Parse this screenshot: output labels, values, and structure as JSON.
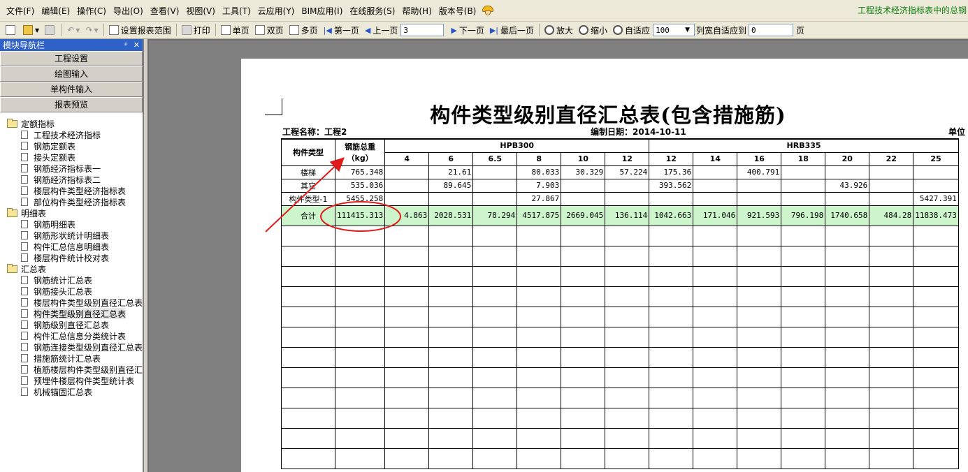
{
  "menu": [
    "文件(F)",
    "编辑(E)",
    "操作(C)",
    "导出(O)",
    "查看(V)",
    "视图(V)",
    "工具(T)",
    "云应用(Y)",
    "BIM应用(I)",
    "在线服务(S)",
    "帮助(H)",
    "版本号(B)"
  ],
  "banner": "工程技术经济指标表中的总钢",
  "toolbar": {
    "set_range": "设置报表范围",
    "print": "打印",
    "single": "单页",
    "double": "双页",
    "multi": "多页",
    "first": "第一页",
    "prev": "上一页",
    "page_value": "3",
    "next": "下一页",
    "last": "最后一页",
    "zoom_in": "放大",
    "zoom_out": "缩小",
    "fit": "自适应",
    "zoom_value": "100",
    "col_fit": "列宽自适应到",
    "col_value": "0",
    "page_unit": "页"
  },
  "nav": {
    "title": "模块导航栏",
    "pin": "ᵖ",
    "close": "✕",
    "buttons": [
      "工程设置",
      "绘图输入",
      "单构件输入",
      "报表预览"
    ],
    "groups": [
      {
        "label": "定额指标",
        "items": [
          "工程技术经济指标",
          "钢筋定额表",
          "接头定额表",
          "钢筋经济指标表一",
          "钢筋经济指标表二",
          "楼层构件类型经济指标表",
          "部位构件类型经济指标表"
        ]
      },
      {
        "label": "明细表",
        "items": [
          "钢筋明细表",
          "钢筋形状统计明细表",
          "构件汇总信息明细表",
          "楼层构件统计校对表"
        ]
      },
      {
        "label": "汇总表",
        "items": [
          "钢筋统计汇总表",
          "钢筋接头汇总表",
          "楼层构件类型级别直径汇总表",
          "构件类型级别直径汇总表",
          "钢筋级别直径汇总表",
          "构件汇总信息分类统计表",
          "钢筋连接类型级别直径汇总表",
          "措施筋统计汇总表",
          "植筋楼层构件类型级别直径汇",
          "预埋件楼层构件类型统计表",
          "机械锚固汇总表"
        ]
      }
    ],
    "selected": "构件类型级别直径汇总表"
  },
  "report": {
    "title": "构件类型级别直径汇总表(包含措施筋)",
    "project": "工程名称：工程2",
    "date": "编制日期：2014-10-11",
    "unit": "单位",
    "col_type": "构件类型",
    "col_total": "钢筋总重",
    "col_total_unit": "（kg）",
    "group1": "HPB300",
    "group2": "HRB335",
    "diameters": [
      "4",
      "6",
      "6.5",
      "8",
      "10",
      "12",
      "12",
      "14",
      "16",
      "18",
      "20",
      "22",
      "25"
    ],
    "rows": [
      {
        "name": "楼梯",
        "total": "765.348",
        "cells": [
          "",
          "21.61",
          "",
          "80.033",
          "30.329",
          "57.224",
          "175.36",
          "",
          "400.791",
          "",
          "",
          "",
          ""
        ]
      },
      {
        "name": "其它",
        "total": "535.036",
        "cells": [
          "",
          "89.645",
          "",
          "7.903",
          "",
          "",
          "393.562",
          "",
          "",
          "",
          "43.926",
          "",
          ""
        ]
      },
      {
        "name": "构件类型-1",
        "total": "5455.258",
        "cells": [
          "",
          "",
          "",
          "27.867",
          "",
          "",
          "",
          "",
          "",
          "",
          "",
          "",
          "5427.391"
        ]
      }
    ],
    "total_row": {
      "name": "合计",
      "total": "111415.313",
      "cells": [
        "4.863",
        "2028.531",
        "78.294",
        "4517.875",
        "2669.045",
        "136.114",
        "1042.663",
        "171.046",
        "921.593",
        "796.198",
        "1740.658",
        "484.28",
        "11838.473"
      ]
    },
    "empty_rows": 12
  }
}
